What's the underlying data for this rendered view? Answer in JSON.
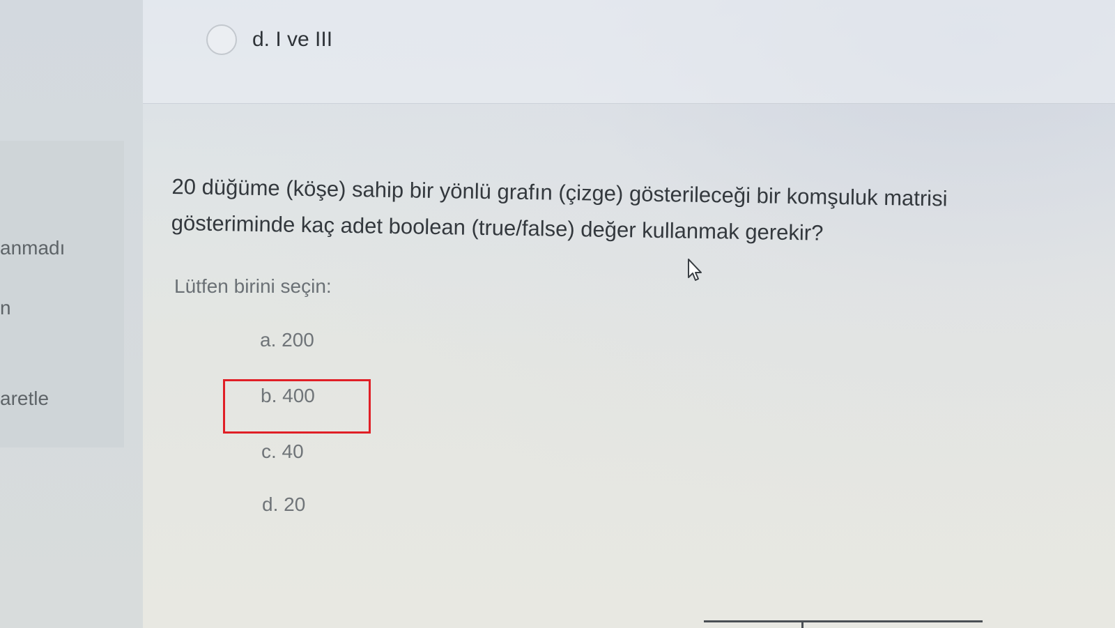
{
  "sidebar": {
    "fragments": [
      "anmadı",
      "n",
      "aretle"
    ]
  },
  "previous_question": {
    "option_d": "d. I ve III"
  },
  "question": {
    "line1": "20 düğüme (köşe) sahip bir yönlü grafın (çizge) gösterileceği bir komşuluk matrisi",
    "line2": "gösteriminde kaç adet boolean (true/false) değer kullanmak gerekir?",
    "prompt": "Lütfen birini seçin:",
    "options": [
      {
        "label": "a. 200"
      },
      {
        "label": "b. 400"
      },
      {
        "label": "c. 40"
      },
      {
        "label": "d. 20"
      }
    ],
    "highlighted_option": "b. 400",
    "highlight_color": "#e01f26"
  }
}
